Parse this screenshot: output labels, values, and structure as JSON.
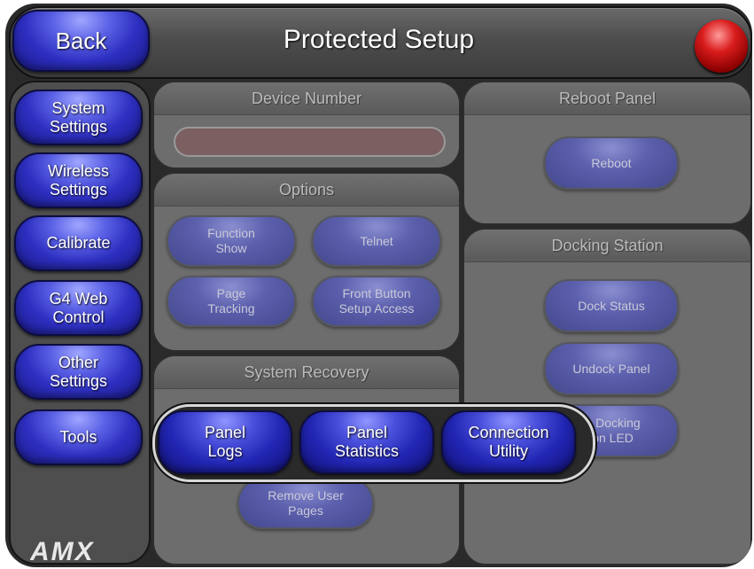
{
  "header": {
    "title": "Protected Setup",
    "back_label": "Back"
  },
  "sidebar": {
    "items": [
      {
        "label": "System\nSettings"
      },
      {
        "label": "Wireless\nSettings"
      },
      {
        "label": "Calibrate"
      },
      {
        "label": "G4 Web\nControl"
      },
      {
        "label": "Other\nSettings"
      },
      {
        "label": "Tools"
      }
    ],
    "logo": "AMX"
  },
  "panels": {
    "device_number": {
      "title": "Device Number",
      "value": ""
    },
    "options": {
      "title": "Options",
      "buttons": [
        "Function\nShow",
        "Telnet",
        "Page\nTracking",
        "Front Button\nSetup Access"
      ]
    },
    "system_recovery": {
      "title": "System Recovery",
      "remove_label": "Remove User\nPages"
    },
    "reboot": {
      "title": "Reboot Panel",
      "button": "Reboot"
    },
    "docking": {
      "title": "Docking Station",
      "buttons": [
        "Dock Status",
        "Undock Panel",
        "le Docking\nion LED"
      ]
    }
  },
  "tools_menu": {
    "items": [
      "Panel\nLogs",
      "Panel\nStatistics",
      "Connection\nUtility"
    ]
  },
  "colors": {
    "accent": "#2d2fc0",
    "led": "#d91c1c",
    "panel": "#6d6d6d"
  }
}
